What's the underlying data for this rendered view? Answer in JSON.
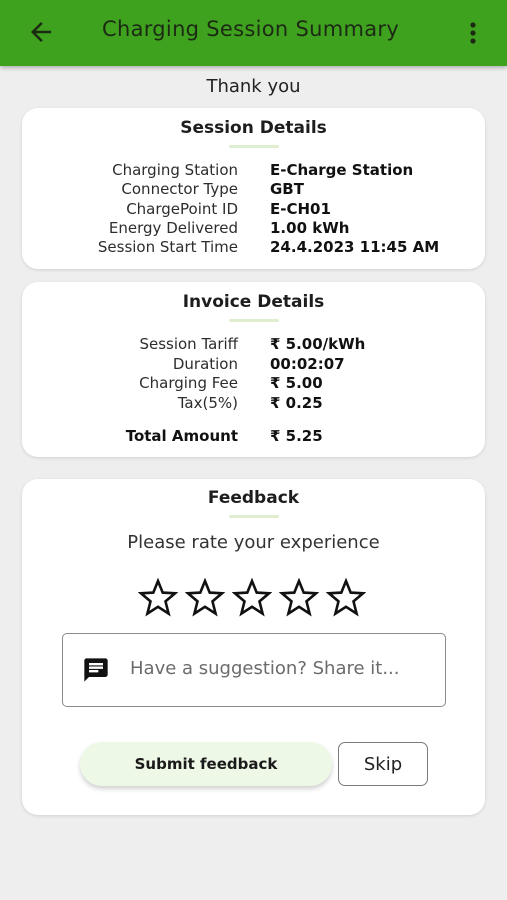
{
  "header": {
    "title": "Charging Session Summary",
    "back_icon": "back-arrow-icon",
    "menu_icon": "more-vertical-icon"
  },
  "thank_you": "Thank you",
  "session": {
    "title": "Session Details",
    "rows": [
      {
        "label": "Charging Station",
        "value": "E-Charge Station"
      },
      {
        "label": "Connector Type",
        "value": "GBT"
      },
      {
        "label": "ChargePoint ID",
        "value": "E-CH01"
      },
      {
        "label": "Energy Delivered",
        "value": "1.00 kWh"
      },
      {
        "label": "Session Start Time",
        "value": "24.4.2023 11:45 AM"
      }
    ]
  },
  "invoice": {
    "title": "Invoice Details",
    "rows": [
      {
        "label": "Session Tariff",
        "value": "₹ 5.00/kWh"
      },
      {
        "label": "Duration",
        "value": "00:02:07"
      },
      {
        "label": "Charging Fee",
        "value": "₹ 5.00"
      },
      {
        "label": "Tax(5%)",
        "value": "₹ 0.25"
      }
    ],
    "total_label": "Total Amount",
    "total_value": "₹ 5.25"
  },
  "feedback": {
    "title": "Feedback",
    "prompt": "Please rate your experience",
    "rating": 0,
    "max_rating": 5,
    "placeholder": "Have a suggestion? Share it...",
    "submit_label": "Submit feedback",
    "skip_label": "Skip",
    "chat_icon": "chat-message-icon"
  },
  "colors": {
    "accent": "#3fa21f",
    "submit_bg": "#eef8e6"
  }
}
